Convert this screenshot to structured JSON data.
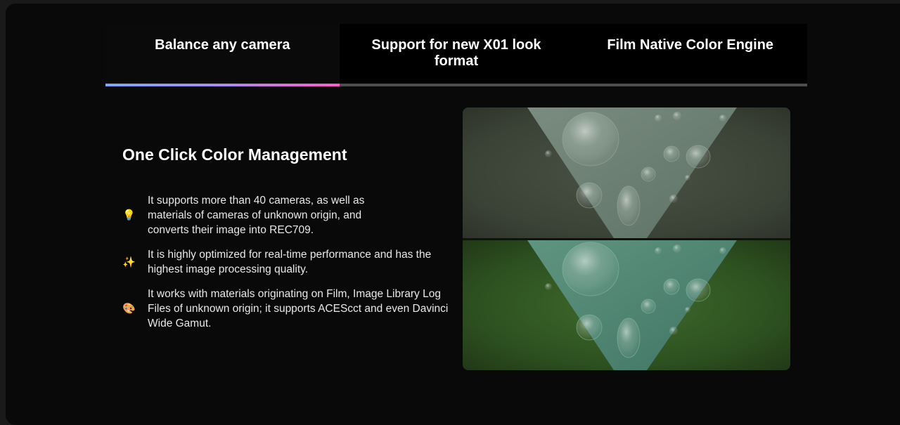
{
  "tabs": [
    {
      "label": "Balance any camera",
      "active": true
    },
    {
      "label": "Support for new X01 look format",
      "active": false
    },
    {
      "label": "Film Native Color Engine",
      "active": false
    }
  ],
  "content": {
    "heading": "One Click Color Management",
    "features": [
      {
        "icon": "lightbulb-icon",
        "glyph": "💡",
        "text": "It supports more than 40 cameras, as well as materials of cameras of unknown origin, and converts their image into REC709."
      },
      {
        "icon": "sparkles-icon",
        "glyph": "✨",
        "text": "It is highly optimized for real-time performance and has the highest image processing quality."
      },
      {
        "icon": "palette-icon",
        "glyph": "🎨",
        "text": "It works with materials originating on Film, Image Library Log Files of unknown origin; it supports ACEScct and even Davinci Wide Gamut."
      }
    ]
  },
  "colors": {
    "background": "#090909",
    "tab_active_gradient": [
      "#7ba8ff",
      "#a98cf0",
      "#ff5ec8"
    ],
    "tab_inactive_line": "#4d4d4d"
  }
}
